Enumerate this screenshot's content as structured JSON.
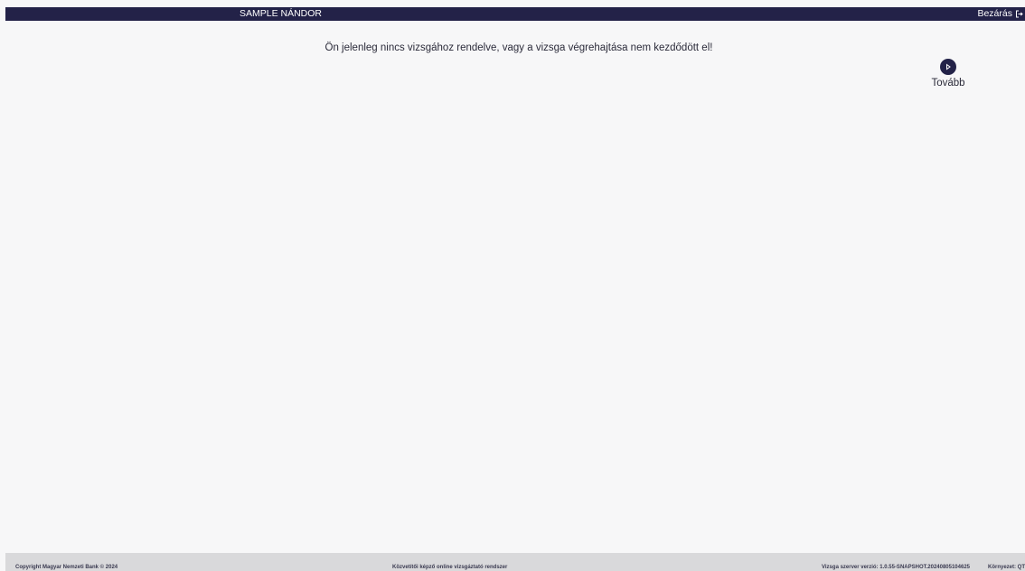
{
  "header": {
    "user_name": "SAMPLE NÁNDOR",
    "close_label": "Bezárás"
  },
  "main": {
    "message": "Ön jelenleg nincs vizsgához rendelve, vagy a vizsga végrehajtása nem kezdődött el!",
    "next_label": "Tovább"
  },
  "footer": {
    "copyright": "Copyright Magyar Nemzeti Bank © 2024",
    "system_name": "Közvetítői képző online vizsgáztató rendszer",
    "version": "Vizsga szerver verzió: 1.0.55-SNAPSHOT.20240805104625",
    "environment": "Környezet: QT"
  },
  "colors": {
    "header_bg": "#232248",
    "page_bg": "#f7f7f8",
    "footer_bg": "#d9d9db",
    "accent": "#232248"
  },
  "icons": {
    "close": "logout-icon",
    "next": "play-circle-icon"
  }
}
